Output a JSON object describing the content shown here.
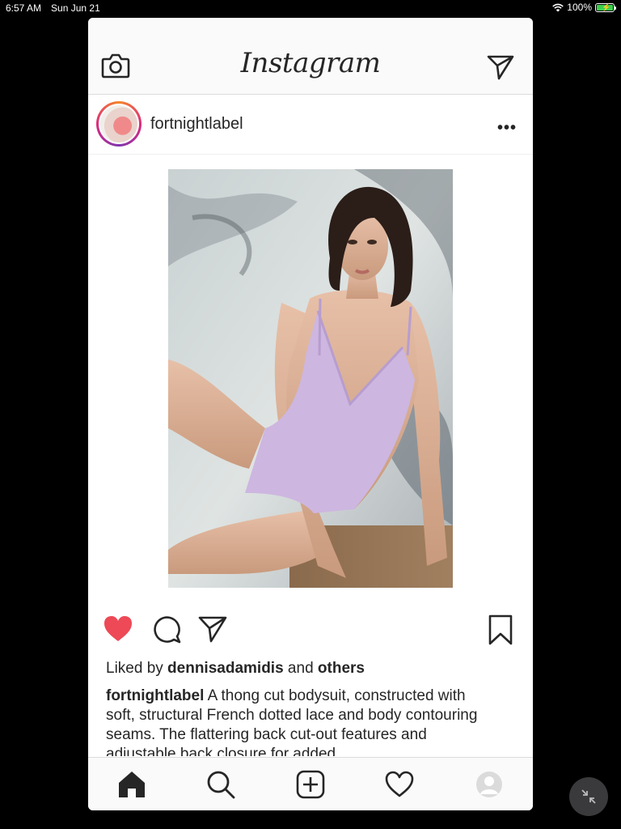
{
  "status": {
    "time": "6:57 AM",
    "date": "Sun Jun 21",
    "battery_percent": "100%"
  },
  "header": {
    "logo": "Instagram",
    "camera_icon": "camera-icon",
    "dm_icon": "paper-plane-icon"
  },
  "post": {
    "username": "fortnightlabel",
    "more": "•••",
    "liked": true,
    "likes": {
      "prefix": "Liked by ",
      "user": "dennisadamidis",
      "middle": " and ",
      "others": "others"
    },
    "caption": {
      "user": "fortnightlabel",
      "text": " A thong cut bodysuit, constructed with soft, structural French dotted lace and body contouring seams. The flattering back cut-out features and adjustable back closure for added"
    }
  },
  "nav": {
    "items": [
      "home-icon",
      "search-icon",
      "new-post-icon",
      "activity-heart-icon",
      "profile-icon"
    ]
  },
  "colors": {
    "like": "#ed4956",
    "text": "#262626",
    "divider": "#dbdbdb"
  }
}
